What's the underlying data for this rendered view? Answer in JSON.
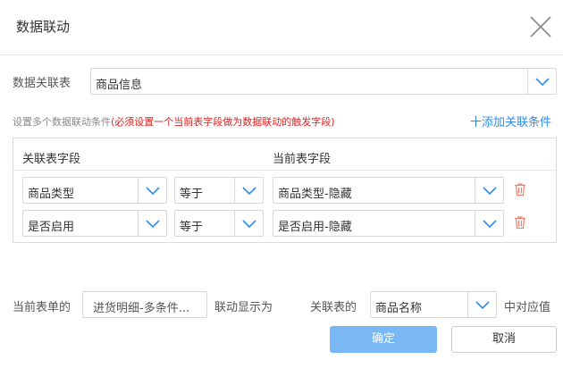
{
  "dialog": {
    "title": "数据联动"
  },
  "related_table": {
    "label": "数据关联表",
    "value": "商品信息"
  },
  "conditions": {
    "hint_prefix": "设置多个数据联动条件",
    "hint_required": "(必须设置一个当前表字段做为数据联动的触发字段)",
    "add_link": "十添加关联条件",
    "col_related": "关联表字段",
    "col_current": "当前表字段",
    "rows": [
      {
        "related_field": "商品类型",
        "operator": "等于",
        "current_field": "商品类型-隐藏"
      },
      {
        "related_field": "是否启用",
        "operator": "等于",
        "current_field": "是否启用-隐藏"
      }
    ]
  },
  "display": {
    "label_current": "当前表单的",
    "current_value": "进货明细-多条件...",
    "label_show_as": "联动显示为",
    "label_related": "关联表的",
    "related_value": "商品名称",
    "label_suffix": "中对应值"
  },
  "buttons": {
    "ok": "确定",
    "cancel": "取消"
  },
  "colors": {
    "accent": "#2d8cf0",
    "required_text": "#e02020",
    "delete_icon": "#f08070",
    "ok_button": "#7ab8f5"
  }
}
